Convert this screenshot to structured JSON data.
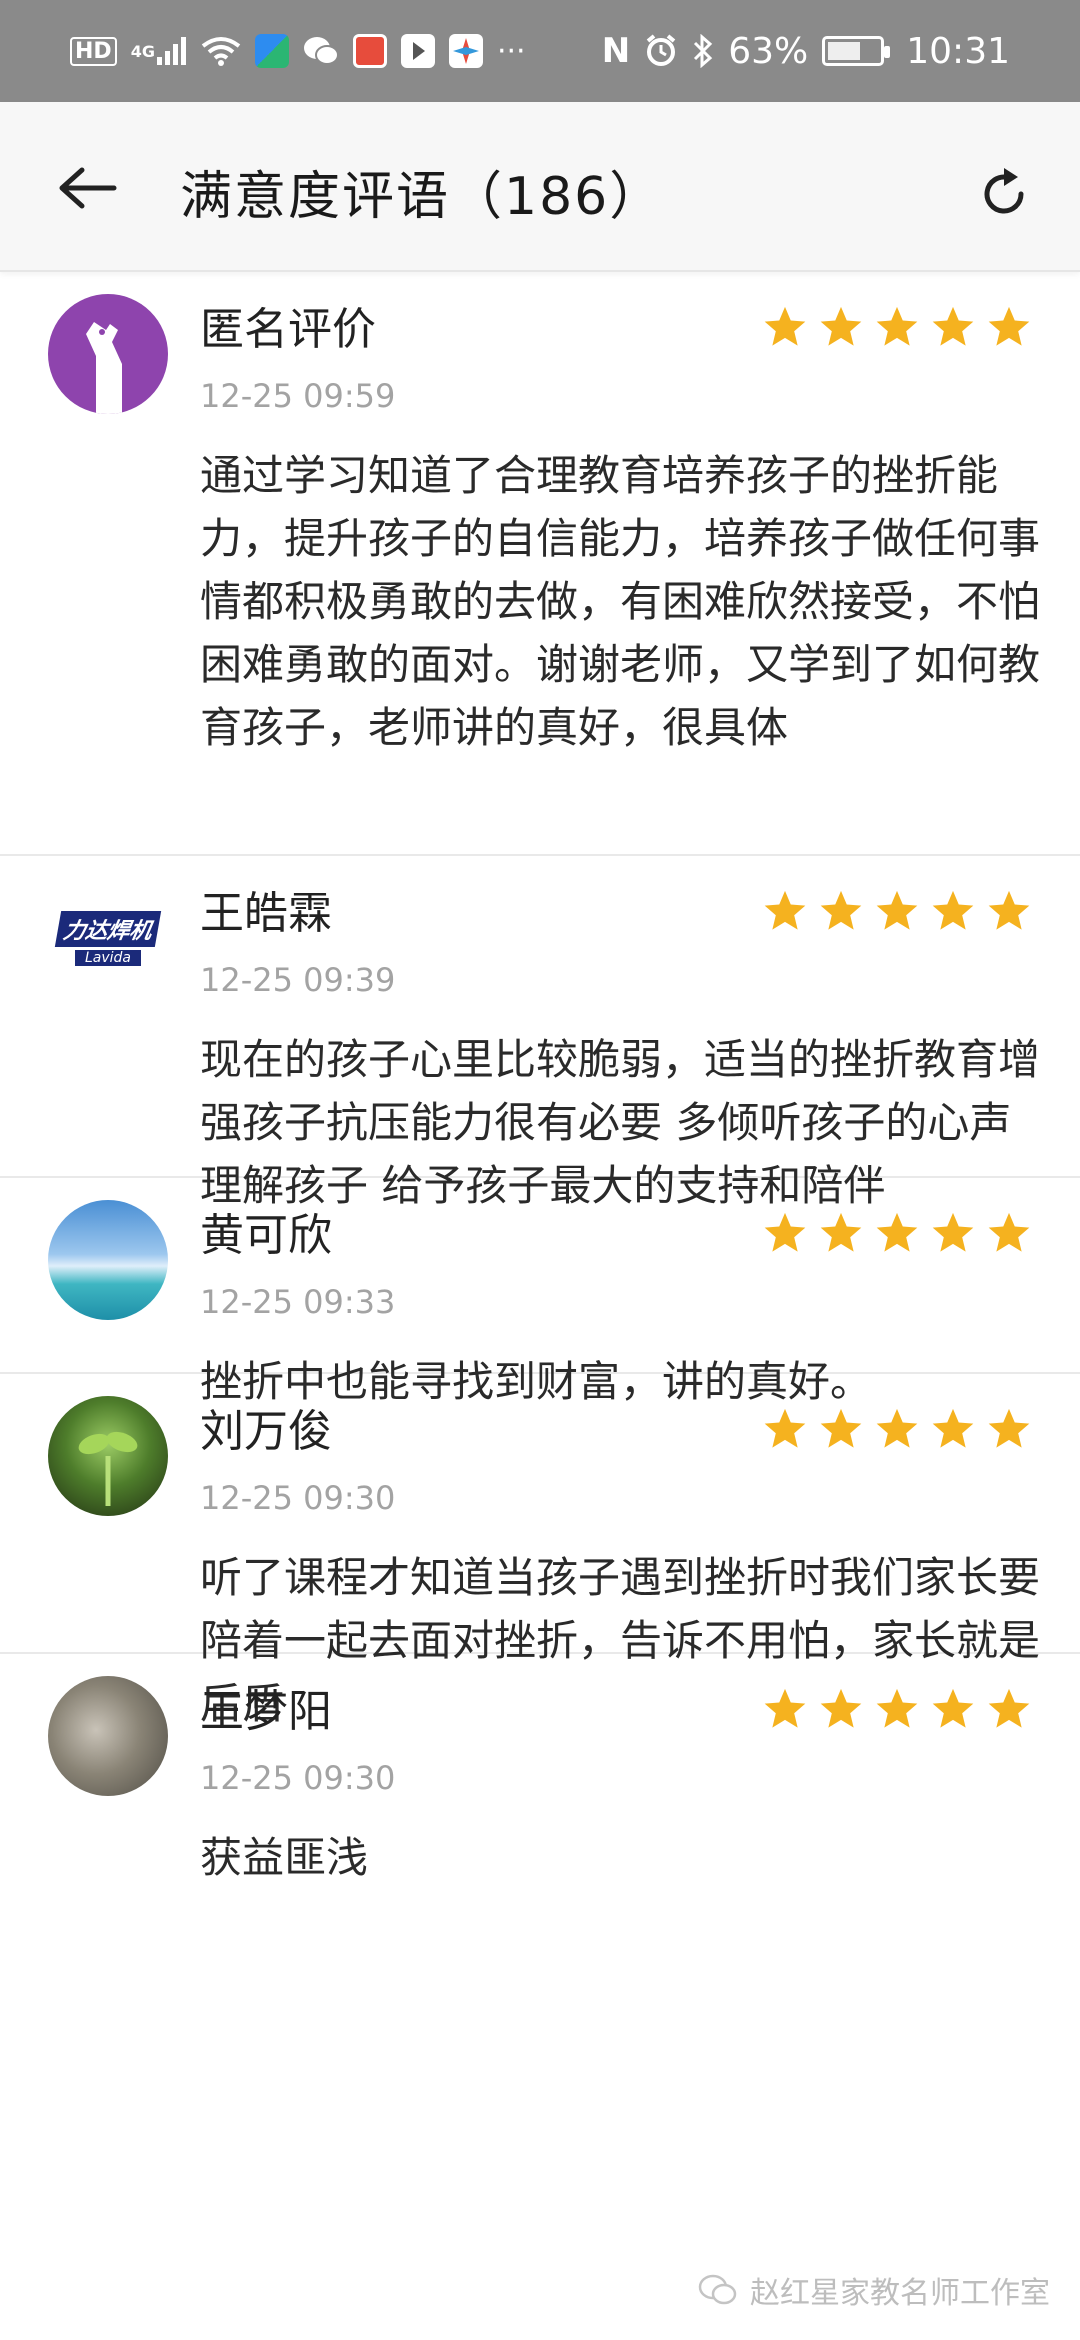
{
  "status_bar": {
    "left_icons": [
      "hd-icon",
      "4g-signal-icon",
      "wifi-icon",
      "app-icon",
      "wechat-icon",
      "app-icon",
      "app-icon",
      "browser-icon"
    ],
    "more": "···",
    "battery_percent": "63%",
    "battery_level": 0.63,
    "time": "10:31",
    "hd_label": "HD",
    "network_label": "4G"
  },
  "header": {
    "title": "满意度评语（186）"
  },
  "accent_color": "#f5b21f",
  "reviews": [
    {
      "name": "匿名评价",
      "time": "12-25 09:59",
      "rating": 5,
      "content": "通过学习知道了合理教育培养孩子的挫折能力，提升孩子的自信能力，培养孩子做任何事情都积极勇敢的去做，有困难欣然接受，不怕困难勇敢的面对。谢谢老师，又学到了如何教育孩子，老师讲的真好，很具体"
    },
    {
      "name": "王皓霖",
      "time": "12-25 09:39",
      "rating": 5,
      "avatar_text": "力达焊机",
      "avatar_subtext": "Lavida",
      "content": "现在的孩子心里比较脆弱，适当的挫折教育增强孩子抗压能力很有必要 多倾听孩子的心声 理解孩子 给予孩子最大的支持和陪伴"
    },
    {
      "name": "黄可欣",
      "time": "12-25 09:33",
      "rating": 5,
      "content": "挫折中也能寻找到财富，讲的真好。"
    },
    {
      "name": "刘万俊",
      "time": "12-25 09:30",
      "rating": 5,
      "content": "听了课程才知道当孩子遇到挫折时我们家长要陪着一起去面对挫折，告诉不用怕，家长就是后盾"
    },
    {
      "name": "王梦阳",
      "time": "12-25 09:30",
      "rating": 5,
      "content": "获益匪浅"
    }
  ],
  "watermark": "赵红星家教名师工作室"
}
